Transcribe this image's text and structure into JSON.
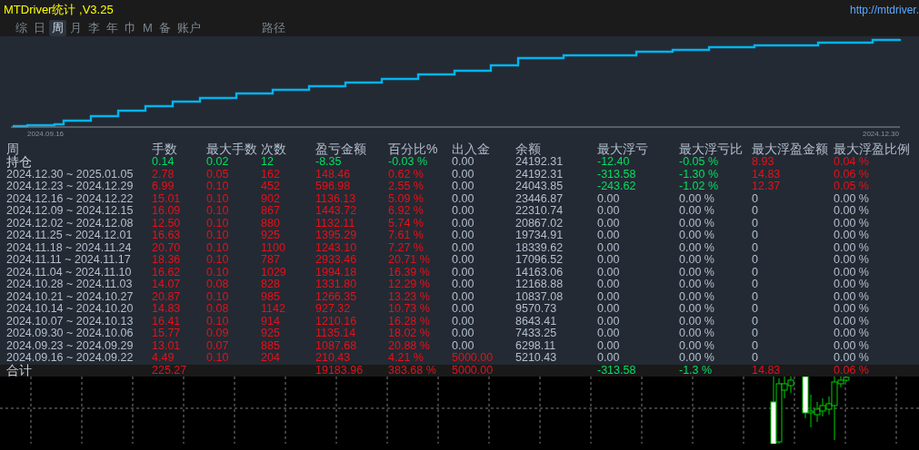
{
  "window": {
    "title": "MTDriver统计 ,V3.25",
    "link": "http://mtdriver."
  },
  "tabs": [
    {
      "label": "综",
      "selected": false
    },
    {
      "label": "日",
      "selected": false
    },
    {
      "label": "周",
      "selected": true
    },
    {
      "label": "月",
      "selected": false
    },
    {
      "label": "李",
      "selected": false
    },
    {
      "label": "年",
      "selected": false
    },
    {
      "label": "巾",
      "selected": false
    },
    {
      "label": "M",
      "selected": false
    },
    {
      "label": "备",
      "selected": false
    },
    {
      "label": "账户",
      "selected": false
    },
    {
      "label": "路径",
      "selected": false,
      "kind": "far"
    }
  ],
  "equity_chart": {
    "start_label": "2024.09.16",
    "end_label": "2024.12.30"
  },
  "table": {
    "columns": [
      {
        "label": "周"
      },
      {
        "label": "手数"
      },
      {
        "label": "最大手数"
      },
      {
        "label": "次数"
      },
      {
        "label": "盈亏金额"
      },
      {
        "label": "百分比%"
      },
      {
        "label": "出入金"
      },
      {
        "label": "余额"
      },
      {
        "label": "最大浮亏"
      },
      {
        "label": "最大浮亏比"
      },
      {
        "label": "最大浮盈金额"
      },
      {
        "label": "最大浮盈比例"
      }
    ],
    "rows": [
      {
        "kind": "holding",
        "cells": [
          {
            "text": "持仓",
            "color": "#c8d0dc"
          },
          {
            "text": "0.14",
            "color": "#00e060"
          },
          {
            "text": "0.02",
            "color": "#00e060"
          },
          {
            "text": "12",
            "color": "#00e060"
          },
          {
            "text": "-8.35",
            "color": "#00e060"
          },
          {
            "text": "-0.03 %",
            "color": "#00e060"
          },
          {
            "text": "0.00",
            "color": "#b4bfcf"
          },
          {
            "text": "24192.31",
            "color": "#b4bfcf"
          },
          {
            "text": "-12.40",
            "color": "#00e060"
          },
          {
            "text": "-0.05 %",
            "color": "#00e060"
          },
          {
            "text": "8.93",
            "color": "#e8101a"
          },
          {
            "text": "0.04 %",
            "color": "#e8101a"
          }
        ]
      },
      {
        "kind": "week",
        "cells": [
          {
            "text": "2024.12.30 ~ 2025.01.05",
            "color": "#b4bfcf"
          },
          {
            "text": "2.78",
            "color": "#e8101a"
          },
          {
            "text": "0.05",
            "color": "#e8101a"
          },
          {
            "text": "162",
            "color": "#e8101a"
          },
          {
            "text": "148.46",
            "color": "#e8101a"
          },
          {
            "text": "0.62 %",
            "color": "#e8101a"
          },
          {
            "text": "0.00",
            "color": "#b4bfcf"
          },
          {
            "text": "24192.31",
            "color": "#b4bfcf"
          },
          {
            "text": "-313.58",
            "color": "#00e060"
          },
          {
            "text": "-1.30 %",
            "color": "#00e060"
          },
          {
            "text": "14.83",
            "color": "#e8101a"
          },
          {
            "text": "0.06 %",
            "color": "#e8101a"
          }
        ]
      },
      {
        "kind": "week",
        "cells": [
          {
            "text": "2024.12.23 ~ 2024.12.29",
            "color": "#b4bfcf"
          },
          {
            "text": "6.99",
            "color": "#e8101a"
          },
          {
            "text": "0.10",
            "color": "#e8101a"
          },
          {
            "text": "452",
            "color": "#e8101a"
          },
          {
            "text": "596.98",
            "color": "#e8101a"
          },
          {
            "text": "2.55 %",
            "color": "#e8101a"
          },
          {
            "text": "0.00",
            "color": "#b4bfcf"
          },
          {
            "text": "24043.85",
            "color": "#b4bfcf"
          },
          {
            "text": "-243.62",
            "color": "#00e060"
          },
          {
            "text": "-1.02 %",
            "color": "#00e060"
          },
          {
            "text": "12.37",
            "color": "#e8101a"
          },
          {
            "text": "0.05 %",
            "color": "#e8101a"
          }
        ]
      },
      {
        "kind": "week",
        "cells": [
          {
            "text": "2024.12.16 ~ 2024.12.22",
            "color": "#b4bfcf"
          },
          {
            "text": "15.01",
            "color": "#e8101a"
          },
          {
            "text": "0.10",
            "color": "#e8101a"
          },
          {
            "text": "902",
            "color": "#e8101a"
          },
          {
            "text": "1136.13",
            "color": "#e8101a"
          },
          {
            "text": "5.09 %",
            "color": "#e8101a"
          },
          {
            "text": "0.00",
            "color": "#b4bfcf"
          },
          {
            "text": "23446.87",
            "color": "#b4bfcf"
          },
          {
            "text": "0.00",
            "color": "#b4bfcf"
          },
          {
            "text": "0.00 %",
            "color": "#b4bfcf"
          },
          {
            "text": "0",
            "color": "#b4bfcf"
          },
          {
            "text": "0.00 %",
            "color": "#b4bfcf"
          }
        ]
      },
      {
        "kind": "week",
        "cells": [
          {
            "text": "2024.12.09 ~ 2024.12.15",
            "color": "#b4bfcf"
          },
          {
            "text": "16.09",
            "color": "#e8101a"
          },
          {
            "text": "0.10",
            "color": "#e8101a"
          },
          {
            "text": "867",
            "color": "#e8101a"
          },
          {
            "text": "1443.72",
            "color": "#e8101a"
          },
          {
            "text": "6.92 %",
            "color": "#e8101a"
          },
          {
            "text": "0.00",
            "color": "#b4bfcf"
          },
          {
            "text": "22310.74",
            "color": "#b4bfcf"
          },
          {
            "text": "0.00",
            "color": "#b4bfcf"
          },
          {
            "text": "0.00 %",
            "color": "#b4bfcf"
          },
          {
            "text": "0",
            "color": "#b4bfcf"
          },
          {
            "text": "0.00 %",
            "color": "#b4bfcf"
          }
        ]
      },
      {
        "kind": "week",
        "cells": [
          {
            "text": "2024.12.02 ~ 2024.12.08",
            "color": "#b4bfcf"
          },
          {
            "text": "12.50",
            "color": "#e8101a"
          },
          {
            "text": "0.10",
            "color": "#e8101a"
          },
          {
            "text": "880",
            "color": "#e8101a"
          },
          {
            "text": "1132.11",
            "color": "#e8101a"
          },
          {
            "text": "5.74 %",
            "color": "#e8101a"
          },
          {
            "text": "0.00",
            "color": "#b4bfcf"
          },
          {
            "text": "20867.02",
            "color": "#b4bfcf"
          },
          {
            "text": "0.00",
            "color": "#b4bfcf"
          },
          {
            "text": "0.00 %",
            "color": "#b4bfcf"
          },
          {
            "text": "0",
            "color": "#b4bfcf"
          },
          {
            "text": "0.00 %",
            "color": "#b4bfcf"
          }
        ]
      },
      {
        "kind": "week",
        "cells": [
          {
            "text": "2024.11.25 ~ 2024.12.01",
            "color": "#b4bfcf"
          },
          {
            "text": "16.63",
            "color": "#e8101a"
          },
          {
            "text": "0.10",
            "color": "#e8101a"
          },
          {
            "text": "925",
            "color": "#e8101a"
          },
          {
            "text": "1395.29",
            "color": "#e8101a"
          },
          {
            "text": "7.61 %",
            "color": "#e8101a"
          },
          {
            "text": "0.00",
            "color": "#b4bfcf"
          },
          {
            "text": "19734.91",
            "color": "#b4bfcf"
          },
          {
            "text": "0.00",
            "color": "#b4bfcf"
          },
          {
            "text": "0.00 %",
            "color": "#b4bfcf"
          },
          {
            "text": "0",
            "color": "#b4bfcf"
          },
          {
            "text": "0.00 %",
            "color": "#b4bfcf"
          }
        ]
      },
      {
        "kind": "week",
        "cells": [
          {
            "text": "2024.11.18 ~ 2024.11.24",
            "color": "#b4bfcf"
          },
          {
            "text": "20.70",
            "color": "#e8101a"
          },
          {
            "text": "0.10",
            "color": "#e8101a"
          },
          {
            "text": "1100",
            "color": "#e8101a"
          },
          {
            "text": "1243.10",
            "color": "#e8101a"
          },
          {
            "text": "7.27 %",
            "color": "#e8101a"
          },
          {
            "text": "0.00",
            "color": "#b4bfcf"
          },
          {
            "text": "18339.62",
            "color": "#b4bfcf"
          },
          {
            "text": "0.00",
            "color": "#b4bfcf"
          },
          {
            "text": "0.00 %",
            "color": "#b4bfcf"
          },
          {
            "text": "0",
            "color": "#b4bfcf"
          },
          {
            "text": "0.00 %",
            "color": "#b4bfcf"
          }
        ]
      },
      {
        "kind": "week",
        "cells": [
          {
            "text": "2024.11.11 ~ 2024.11.17",
            "color": "#b4bfcf"
          },
          {
            "text": "18.36",
            "color": "#e8101a"
          },
          {
            "text": "0.10",
            "color": "#e8101a"
          },
          {
            "text": "787",
            "color": "#e8101a"
          },
          {
            "text": "2933.46",
            "color": "#e8101a"
          },
          {
            "text": "20.71 %",
            "color": "#e8101a"
          },
          {
            "text": "0.00",
            "color": "#b4bfcf"
          },
          {
            "text": "17096.52",
            "color": "#b4bfcf"
          },
          {
            "text": "0.00",
            "color": "#b4bfcf"
          },
          {
            "text": "0.00 %",
            "color": "#b4bfcf"
          },
          {
            "text": "0",
            "color": "#b4bfcf"
          },
          {
            "text": "0.00 %",
            "color": "#b4bfcf"
          }
        ]
      },
      {
        "kind": "week",
        "cells": [
          {
            "text": "2024.11.04 ~ 2024.11.10",
            "color": "#b4bfcf"
          },
          {
            "text": "16.62",
            "color": "#e8101a"
          },
          {
            "text": "0.10",
            "color": "#e8101a"
          },
          {
            "text": "1029",
            "color": "#e8101a"
          },
          {
            "text": "1994.18",
            "color": "#e8101a"
          },
          {
            "text": "16.39 %",
            "color": "#e8101a"
          },
          {
            "text": "0.00",
            "color": "#b4bfcf"
          },
          {
            "text": "14163.06",
            "color": "#b4bfcf"
          },
          {
            "text": "0.00",
            "color": "#b4bfcf"
          },
          {
            "text": "0.00 %",
            "color": "#b4bfcf"
          },
          {
            "text": "0",
            "color": "#b4bfcf"
          },
          {
            "text": "0.00 %",
            "color": "#b4bfcf"
          }
        ]
      },
      {
        "kind": "week",
        "cells": [
          {
            "text": "2024.10.28 ~ 2024.11.03",
            "color": "#b4bfcf"
          },
          {
            "text": "14.07",
            "color": "#e8101a"
          },
          {
            "text": "0.08",
            "color": "#e8101a"
          },
          {
            "text": "828",
            "color": "#e8101a"
          },
          {
            "text": "1331.80",
            "color": "#e8101a"
          },
          {
            "text": "12.29 %",
            "color": "#e8101a"
          },
          {
            "text": "0.00",
            "color": "#b4bfcf"
          },
          {
            "text": "12168.88",
            "color": "#b4bfcf"
          },
          {
            "text": "0.00",
            "color": "#b4bfcf"
          },
          {
            "text": "0.00 %",
            "color": "#b4bfcf"
          },
          {
            "text": "0",
            "color": "#b4bfcf"
          },
          {
            "text": "0.00 %",
            "color": "#b4bfcf"
          }
        ]
      },
      {
        "kind": "week",
        "cells": [
          {
            "text": "2024.10.21 ~ 2024.10.27",
            "color": "#b4bfcf"
          },
          {
            "text": "20.87",
            "color": "#e8101a"
          },
          {
            "text": "0.10",
            "color": "#e8101a"
          },
          {
            "text": "985",
            "color": "#e8101a"
          },
          {
            "text": "1266.35",
            "color": "#e8101a"
          },
          {
            "text": "13.23 %",
            "color": "#e8101a"
          },
          {
            "text": "0.00",
            "color": "#b4bfcf"
          },
          {
            "text": "10837.08",
            "color": "#b4bfcf"
          },
          {
            "text": "0.00",
            "color": "#b4bfcf"
          },
          {
            "text": "0.00 %",
            "color": "#b4bfcf"
          },
          {
            "text": "0",
            "color": "#b4bfcf"
          },
          {
            "text": "0.00 %",
            "color": "#b4bfcf"
          }
        ]
      },
      {
        "kind": "week",
        "cells": [
          {
            "text": "2024.10.14 ~ 2024.10.20",
            "color": "#b4bfcf"
          },
          {
            "text": "14.83",
            "color": "#e8101a"
          },
          {
            "text": "0.08",
            "color": "#e8101a"
          },
          {
            "text": "1142",
            "color": "#e8101a"
          },
          {
            "text": "927.32",
            "color": "#e8101a"
          },
          {
            "text": "10.73 %",
            "color": "#e8101a"
          },
          {
            "text": "0.00",
            "color": "#b4bfcf"
          },
          {
            "text": "9570.73",
            "color": "#b4bfcf"
          },
          {
            "text": "0.00",
            "color": "#b4bfcf"
          },
          {
            "text": "0.00 %",
            "color": "#b4bfcf"
          },
          {
            "text": "0",
            "color": "#b4bfcf"
          },
          {
            "text": "0.00 %",
            "color": "#b4bfcf"
          }
        ]
      },
      {
        "kind": "week",
        "cells": [
          {
            "text": "2024.10.07 ~ 2024.10.13",
            "color": "#b4bfcf"
          },
          {
            "text": "16.41",
            "color": "#e8101a"
          },
          {
            "text": "0.10",
            "color": "#e8101a"
          },
          {
            "text": "914",
            "color": "#e8101a"
          },
          {
            "text": "1210.16",
            "color": "#e8101a"
          },
          {
            "text": "16.28 %",
            "color": "#e8101a"
          },
          {
            "text": "0.00",
            "color": "#b4bfcf"
          },
          {
            "text": "8643.41",
            "color": "#b4bfcf"
          },
          {
            "text": "0.00",
            "color": "#b4bfcf"
          },
          {
            "text": "0.00 %",
            "color": "#b4bfcf"
          },
          {
            "text": "0",
            "color": "#b4bfcf"
          },
          {
            "text": "0.00 %",
            "color": "#b4bfcf"
          }
        ]
      },
      {
        "kind": "week",
        "cells": [
          {
            "text": "2024.09.30 ~ 2024.10.06",
            "color": "#b4bfcf"
          },
          {
            "text": "15.77",
            "color": "#e8101a"
          },
          {
            "text": "0.09",
            "color": "#e8101a"
          },
          {
            "text": "925",
            "color": "#e8101a"
          },
          {
            "text": "1135.14",
            "color": "#e8101a"
          },
          {
            "text": "18.02 %",
            "color": "#e8101a"
          },
          {
            "text": "0.00",
            "color": "#b4bfcf"
          },
          {
            "text": "7433.25",
            "color": "#b4bfcf"
          },
          {
            "text": "0.00",
            "color": "#b4bfcf"
          },
          {
            "text": "0.00 %",
            "color": "#b4bfcf"
          },
          {
            "text": "0",
            "color": "#b4bfcf"
          },
          {
            "text": "0.00 %",
            "color": "#b4bfcf"
          }
        ]
      },
      {
        "kind": "week",
        "cells": [
          {
            "text": "2024.09.23 ~ 2024.09.29",
            "color": "#b4bfcf"
          },
          {
            "text": "13.01",
            "color": "#e8101a"
          },
          {
            "text": "0.07",
            "color": "#e8101a"
          },
          {
            "text": "885",
            "color": "#e8101a"
          },
          {
            "text": "1087.68",
            "color": "#e8101a"
          },
          {
            "text": "20.88 %",
            "color": "#e8101a"
          },
          {
            "text": "0.00",
            "color": "#b4bfcf"
          },
          {
            "text": "6298.11",
            "color": "#b4bfcf"
          },
          {
            "text": "0.00",
            "color": "#b4bfcf"
          },
          {
            "text": "0.00 %",
            "color": "#b4bfcf"
          },
          {
            "text": "0",
            "color": "#b4bfcf"
          },
          {
            "text": "0.00 %",
            "color": "#b4bfcf"
          }
        ]
      },
      {
        "kind": "week",
        "cells": [
          {
            "text": "2024.09.16 ~ 2024.09.22",
            "color": "#b4bfcf"
          },
          {
            "text": "4.49",
            "color": "#e8101a"
          },
          {
            "text": "0.10",
            "color": "#e8101a"
          },
          {
            "text": "204",
            "color": "#e8101a"
          },
          {
            "text": "210.43",
            "color": "#e8101a"
          },
          {
            "text": "4.21 %",
            "color": "#e8101a"
          },
          {
            "text": "5000.00",
            "color": "#e8101a"
          },
          {
            "text": "5210.43",
            "color": "#b4bfcf"
          },
          {
            "text": "0.00",
            "color": "#b4bfcf"
          },
          {
            "text": "0.00 %",
            "color": "#b4bfcf"
          },
          {
            "text": "0",
            "color": "#b4bfcf"
          },
          {
            "text": "0.00 %",
            "color": "#b4bfcf"
          }
        ]
      },
      {
        "kind": "total",
        "cells": [
          {
            "text": "合计",
            "color": "#c8d0dc"
          },
          {
            "text": "225.27",
            "color": "#e8101a"
          },
          null,
          null,
          {
            "text": "19183.96",
            "color": "#e8101a"
          },
          {
            "text": "383.68 %",
            "color": "#e8101a"
          },
          {
            "text": "5000.00",
            "color": "#e8101a"
          },
          null,
          {
            "text": "-313.58",
            "color": "#00e060"
          },
          {
            "text": "-1.3 %",
            "color": "#00e060"
          },
          {
            "text": "14.83",
            "color": "#e8101a"
          },
          {
            "text": "0.06 %",
            "color": "#e8101a"
          }
        ]
      }
    ]
  }
}
